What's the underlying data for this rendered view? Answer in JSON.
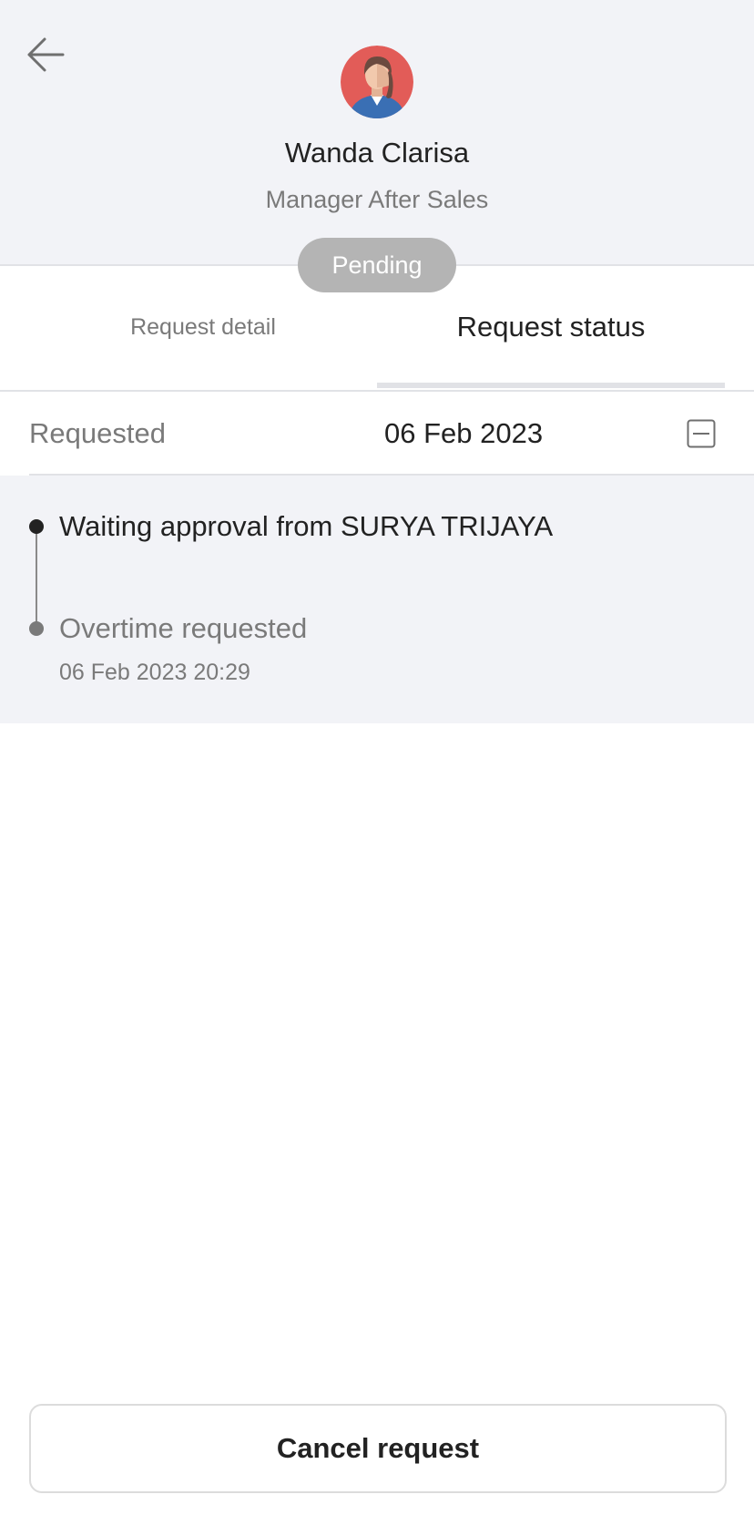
{
  "header": {
    "back_icon": "arrow-left-icon",
    "avatar_icon": "female-avatar-icon",
    "name": "Wanda Clarisa",
    "role": "Manager After Sales",
    "status": "Pending"
  },
  "tabs": [
    {
      "label": "Request detail",
      "active": false
    },
    {
      "label": "Request status",
      "active": true
    }
  ],
  "summary": {
    "label": "Requested",
    "date": "06 Feb 2023",
    "toggle_icon": "collapse-icon"
  },
  "timeline": [
    {
      "title": "Waiting approval from SURYA TRIJAYA",
      "time": ""
    },
    {
      "title": "Overtime requested",
      "time": "06 Feb 2023 20:29"
    }
  ],
  "footer": {
    "cancel_label": "Cancel request"
  },
  "colors": {
    "header_bg": "#f2f3f7",
    "pill_bg": "#b4b4b4",
    "text_primary": "#222222",
    "text_secondary": "#7a7a7a",
    "divider": "#e1e2e6"
  }
}
